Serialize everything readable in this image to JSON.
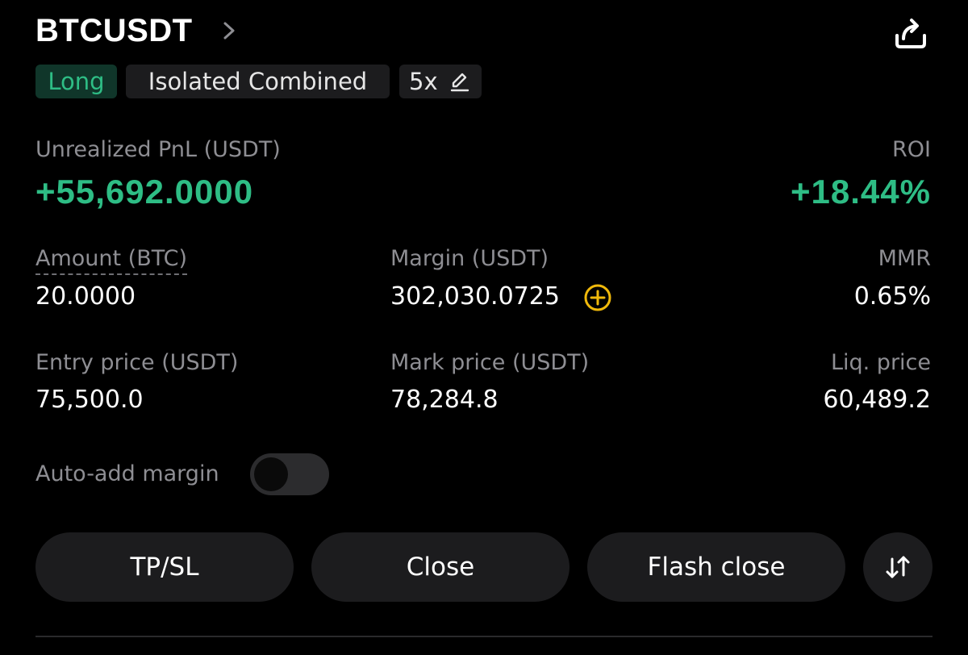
{
  "header": {
    "symbol": "BTCUSDT",
    "chevron_icon": "chevron-right-icon",
    "share_icon": "share-icon"
  },
  "tags": {
    "side": "Long",
    "margin_mode": "Isolated Combined",
    "leverage": "5x",
    "edit_icon": "edit-icon"
  },
  "pnl": {
    "label": "Unrealized PnL (USDT)",
    "value": "+55,692.0000",
    "roi_label": "ROI",
    "roi_value": "+18.44%"
  },
  "stats": {
    "amount_label": "Amount (BTC)",
    "amount_value": "20.0000",
    "margin_label": "Margin (USDT)",
    "margin_value": "302,030.0725",
    "mmr_label": "MMR",
    "mmr_value": "0.65%",
    "entry_label": "Entry price (USDT)",
    "entry_value": "75,500.0",
    "mark_label": "Mark price (USDT)",
    "mark_value": "78,284.8",
    "liq_label": "Liq. price",
    "liq_value": "60,489.2"
  },
  "auto_margin": {
    "label": "Auto-add margin",
    "enabled": false
  },
  "actions": {
    "tpsl_label": "TP/SL",
    "close_label": "Close",
    "flash_close_label": "Flash close",
    "swap_icon": "swap-arrows-icon"
  },
  "colors": {
    "positive": "#2ebd85",
    "long_tag_bg": "#10362a",
    "accent_yellow": "#f0b90b",
    "surface": "#1c1c1e",
    "label_gray": "#8e8e93",
    "background": "#000000"
  }
}
